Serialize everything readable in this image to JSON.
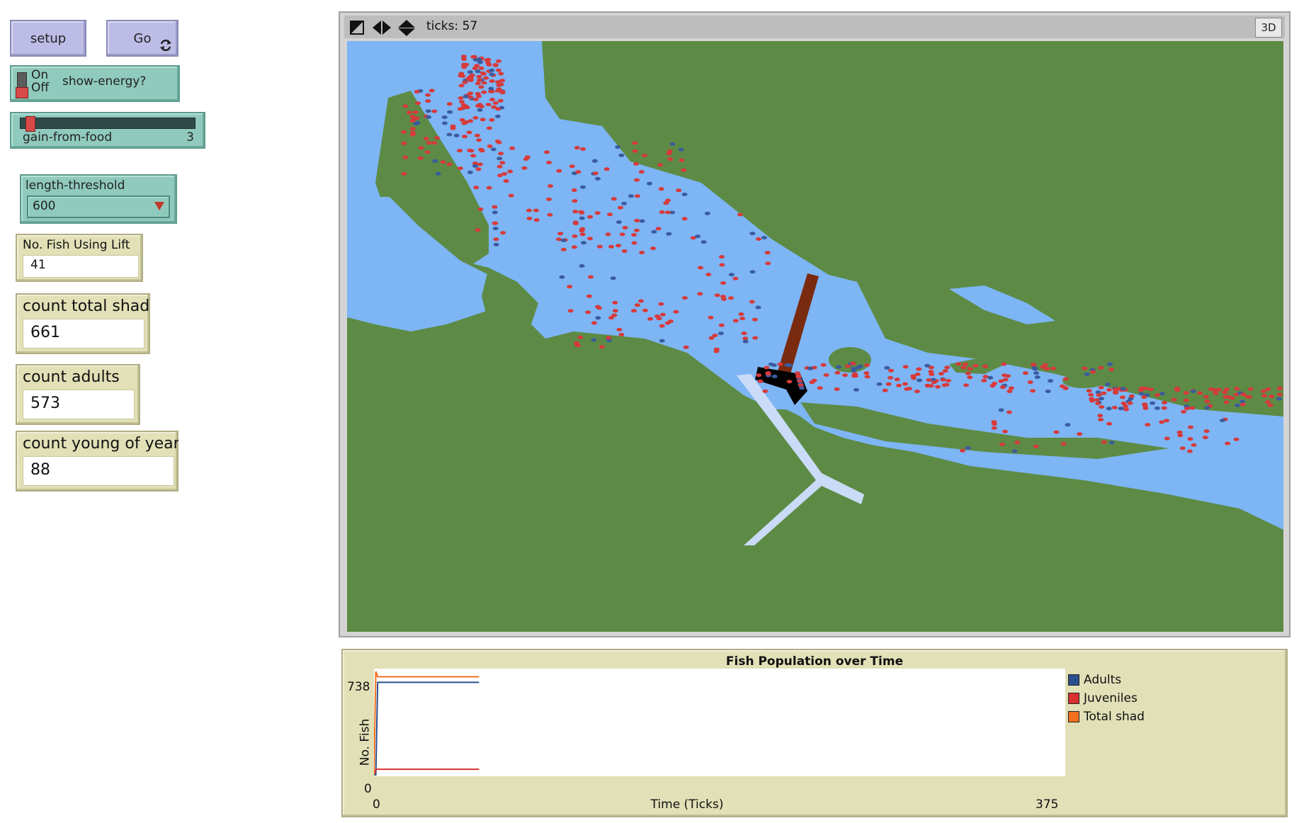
{
  "buttons": {
    "setup_label": "setup",
    "go_label": "Go"
  },
  "switch": {
    "on_label": "On",
    "off_label": "Off",
    "name": "show-energy?",
    "state": "off"
  },
  "slider": {
    "name": "gain-from-food",
    "value": "3",
    "min": 0,
    "max": 100
  },
  "chooser": {
    "name": "length-threshold",
    "value": "600"
  },
  "monitors": [
    {
      "label": "No. Fish Using Lift",
      "value": "41"
    },
    {
      "label": "count total shad",
      "value": "661"
    },
    {
      "label": "count adults",
      "value": "573"
    },
    {
      "label": "count young of year",
      "value": "88"
    }
  ],
  "view": {
    "ticks_text": "ticks: 57",
    "btn_3d": "3D",
    "colors": {
      "land": "#5d8b45",
      "water": "#7db5f5",
      "channel": "#c9dbf7",
      "dam": "#7a2a0f",
      "lift": "#000000",
      "fish_red": "#d73a3a",
      "fish_blue": "#3a5c9e"
    }
  },
  "plot": {
    "title": "Fish Population over Time",
    "xlabel": "Time (Ticks)",
    "ylabel": "No. Fish",
    "x_min": "0",
    "x_max": "375",
    "y_min": "0",
    "y_max": "738",
    "legend": [
      {
        "name": "Adults",
        "color": "#2a4f8f"
      },
      {
        "name": "Juveniles",
        "color": "#d93030"
      },
      {
        "name": "Total shad",
        "color": "#f07020"
      }
    ]
  },
  "chart_data": {
    "type": "line",
    "title": "Fish Population over Time",
    "xlabel": "Time (Ticks)",
    "ylabel": "No. Fish",
    "xlim": [
      0,
      375
    ],
    "ylim": [
      0,
      738
    ],
    "series": [
      {
        "name": "Adults",
        "color": "#2a4f8f",
        "points": [
          [
            0,
            0
          ],
          [
            1,
            0
          ],
          [
            2,
            660
          ],
          [
            57,
            660
          ]
        ]
      },
      {
        "name": "Juveniles",
        "color": "#d93030",
        "points": [
          [
            0,
            0
          ],
          [
            1,
            40
          ],
          [
            57,
            40
          ]
        ]
      },
      {
        "name": "Total shad",
        "color": "#f07020",
        "points": [
          [
            0,
            0
          ],
          [
            1,
            738
          ],
          [
            2,
            700
          ],
          [
            57,
            700
          ]
        ]
      }
    ]
  }
}
